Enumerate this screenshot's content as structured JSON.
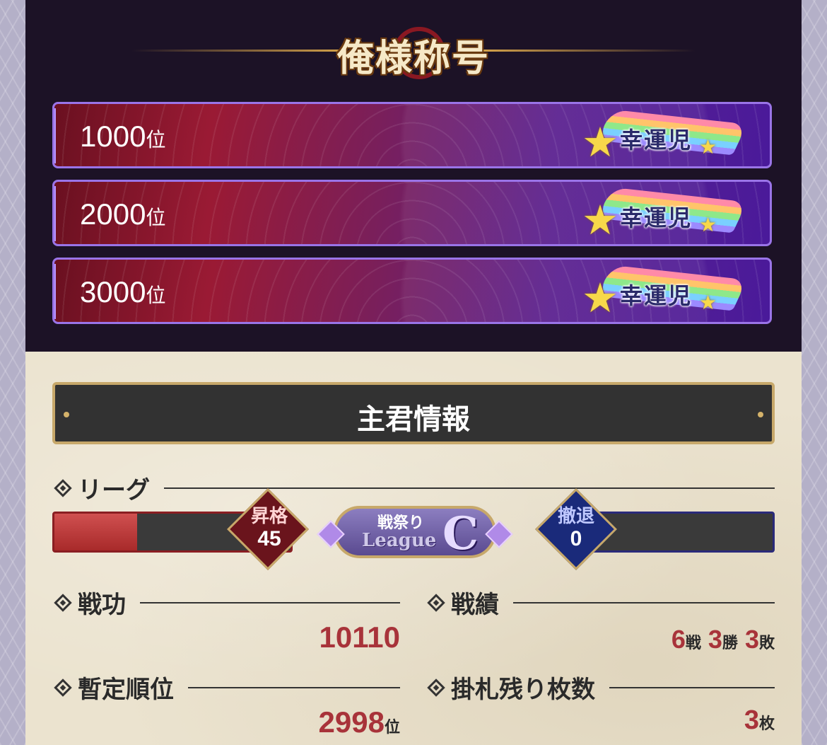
{
  "title": "俺様称号",
  "rank_rewards": [
    {
      "rank": "1000",
      "unit": "位",
      "badge": "幸運児"
    },
    {
      "rank": "2000",
      "unit": "位",
      "badge": "幸運児"
    },
    {
      "rank": "3000",
      "unit": "位",
      "badge": "幸運児"
    }
  ],
  "info": {
    "header": "主君情報",
    "league": {
      "heading": "リーグ",
      "promotion_label": "昇格",
      "promotion_value": "45",
      "promotion_progress": 0.35,
      "league_top": "戦祭り",
      "league_word": "League",
      "league_letter": "C",
      "retreat_label": "撤退",
      "retreat_value": "0"
    },
    "merit": {
      "heading": "戦功",
      "value": "10110"
    },
    "record": {
      "heading": "戦績",
      "battles": "6",
      "battles_unit": "戦",
      "wins": "3",
      "wins_unit": "勝",
      "losses": "3",
      "losses_unit": "敗"
    },
    "provisional_rank": {
      "heading": "暫定順位",
      "value": "2998",
      "unit": "位"
    },
    "remaining_tags": {
      "heading": "掛札残り枚数",
      "value": "3",
      "unit": "枚"
    }
  },
  "colors": {
    "accent_red": "#a8333a",
    "gold": "#c7a86a",
    "purple_border": "#9a74e8"
  }
}
